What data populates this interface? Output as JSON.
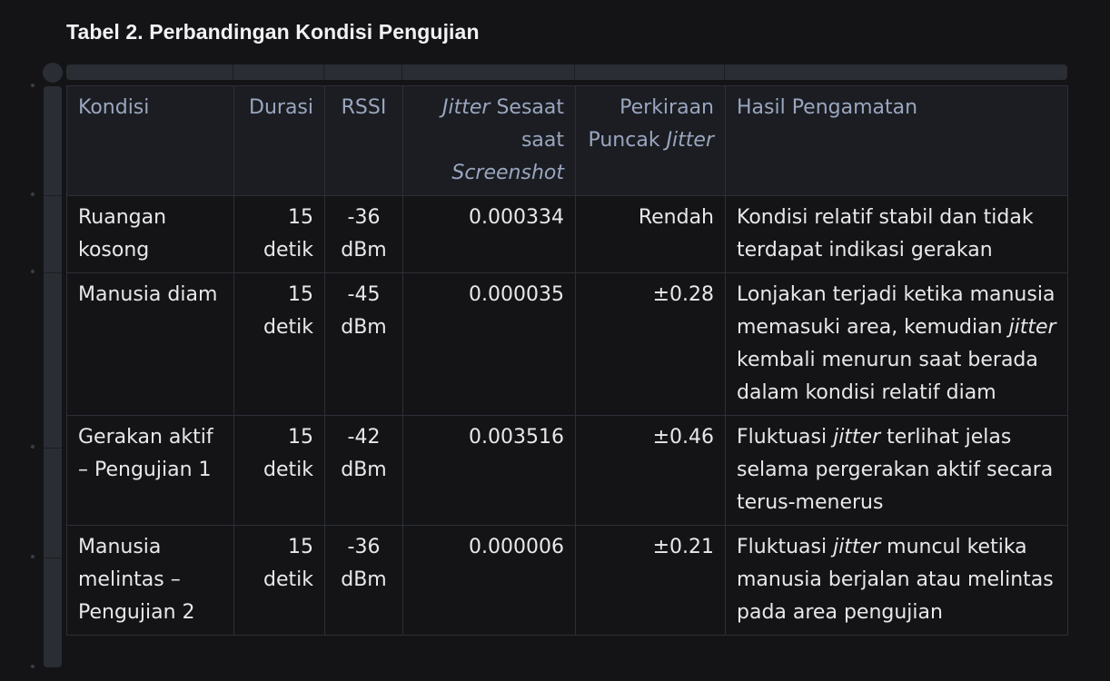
{
  "caption": "Tabel 2. Perbandingan Kondisi Pengujian",
  "table": {
    "headers": {
      "kondisi": "Kondisi",
      "durasi": "Durasi",
      "rssi": "RSSI",
      "jitter_sesaat_em": "Jitter",
      "jitter_sesaat_rest": " Sesaat saat ",
      "jitter_sesaat_em2": "Screenshot",
      "puncak_text": "Perkiraan Puncak ",
      "puncak_em": "Jitter",
      "hasil": "Hasil Pengamatan"
    },
    "rows": [
      {
        "kondisi": "Ruangan kosong",
        "durasi": "15 detik",
        "rssi": "-36 dBm",
        "jitter": "0.000334",
        "puncak": "Rendah",
        "hasil_a": "Kondisi relatif stabil dan tidak terdapat indikasi gerakan",
        "hasil_em": "",
        "hasil_b": ""
      },
      {
        "kondisi": "Manusia diam",
        "durasi": "15 detik",
        "rssi": "-45 dBm",
        "jitter": "0.000035",
        "puncak": "±0.28",
        "hasil_a": "Lonjakan terjadi ketika manusia memasuki area, kemudian ",
        "hasil_em": "jitter",
        "hasil_b": " kembali menurun saat berada dalam kondisi relatif diam"
      },
      {
        "kondisi": "Gerakan aktif – Pengujian 1",
        "durasi": "15 detik",
        "rssi": "-42 dBm",
        "jitter": "0.003516",
        "puncak": "±0.46",
        "hasil_a": "Fluktuasi ",
        "hasil_em": "jitter",
        "hasil_b": " terlihat jelas selama pergerakan aktif secara terus-menerus"
      },
      {
        "kondisi": "Manusia melintas – Pengujian 2",
        "durasi": "15 detik",
        "rssi": "-36 dBm",
        "jitter": "0.000006",
        "puncak": "±0.21",
        "hasil_a": "Fluktuasi ",
        "hasil_em": "jitter",
        "hasil_b": " muncul ketika manusia berjalan atau melintas pada area pengujian"
      }
    ]
  }
}
